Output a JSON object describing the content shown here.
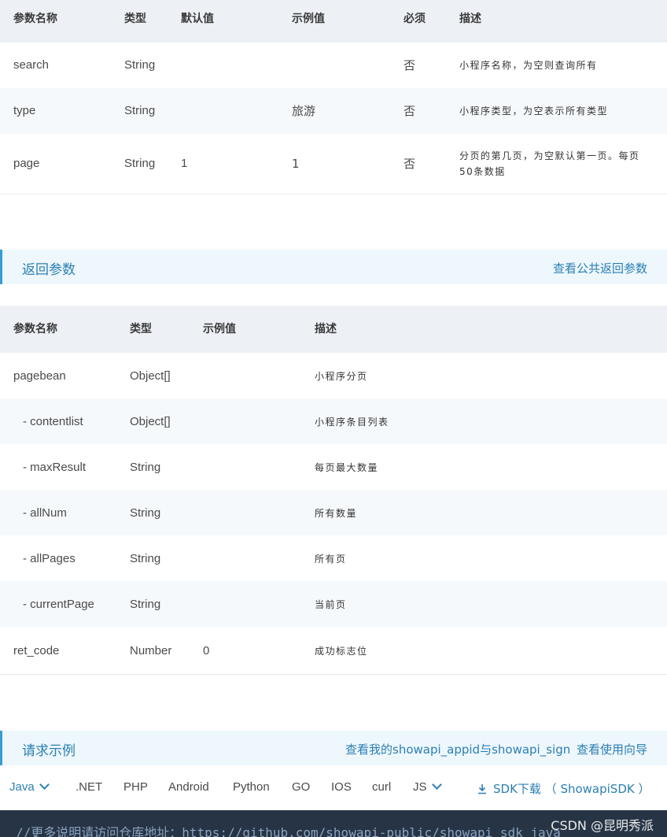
{
  "request_params": {
    "headers": [
      "参数名称",
      "类型",
      "默认值",
      "示例值",
      "必须",
      "描述"
    ],
    "rows": [
      {
        "name": "search",
        "type": "String",
        "default": "",
        "example": "",
        "required": "否",
        "desc": "小程序名称，为空则查询所有"
      },
      {
        "name": "type",
        "type": "String",
        "default": "",
        "example": "旅游",
        "required": "否",
        "desc": "小程序类型，为空表示所有类型"
      },
      {
        "name": "page",
        "type": "String",
        "default": "1",
        "example": "1",
        "required": "否",
        "desc": "分页的第几页，为空默认第一页。每页50条数据"
      }
    ]
  },
  "return_section": {
    "title": "返回参数",
    "link": "查看公共返回参数"
  },
  "return_params": {
    "headers": [
      "参数名称",
      "类型",
      "示例值",
      "描述"
    ],
    "rows": [
      {
        "name": "pagebean",
        "type": "Object[]",
        "example": "",
        "desc": "小程序分页"
      },
      {
        "name": "- contentlist",
        "type": "Object[]",
        "example": "",
        "desc": "小程序条目列表"
      },
      {
        "name": "- maxResult",
        "type": "String",
        "example": "",
        "desc": "每页最大数量"
      },
      {
        "name": "- allNum",
        "type": "String",
        "example": "",
        "desc": "所有数量"
      },
      {
        "name": "- allPages",
        "type": "String",
        "example": "",
        "desc": "所有页"
      },
      {
        "name": "- currentPage",
        "type": "String",
        "example": "",
        "desc": "当前页"
      },
      {
        "name": "ret_code",
        "type": "Number",
        "example": "0",
        "desc": "成功标志位"
      }
    ]
  },
  "example_section": {
    "title": "请求示例",
    "link1": "查看我的showapi_appid与showapi_sign",
    "link2": "查看使用向导"
  },
  "tabs": [
    "Java",
    ".NET",
    "PHP",
    "Android",
    "Python",
    "GO",
    "IOS",
    "curl",
    "JS"
  ],
  "sdk_link": "SDK下载 （ ShowapiSDK ）",
  "code_line": "//更多说明请访问仓库地址：https://github.com/showapi-public/showapi_sdk_java",
  "watermark": "CSDN @昆明秀派",
  "colors": {
    "accent": "#2b7fb3",
    "header_bg": "#edf1f5",
    "code_bg": "#273445"
  }
}
